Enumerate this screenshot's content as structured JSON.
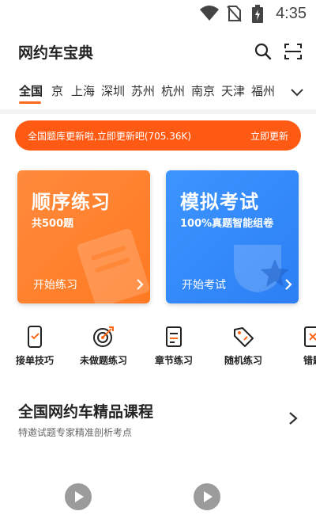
{
  "status_bar": {
    "time": "4:35"
  },
  "header": {
    "title": "网约车宝典"
  },
  "tabs": {
    "items": [
      {
        "label": "全国",
        "active": true
      },
      {
        "label": "京"
      },
      {
        "label": "上海"
      },
      {
        "label": "深圳"
      },
      {
        "label": "苏州"
      },
      {
        "label": "杭州"
      },
      {
        "label": "南京"
      },
      {
        "label": "天津"
      },
      {
        "label": "福州"
      }
    ]
  },
  "banner": {
    "message": "全国题库更新啦,立即更新吧(705.36K)",
    "action": "立即更新"
  },
  "cards": [
    {
      "title": "顺序练习",
      "subtitle": "共500题",
      "start": "开始练习",
      "color": "#ff7a22"
    },
    {
      "title": "模拟考试",
      "subtitle": "100%真题智能组卷",
      "start": "开始考试",
      "color": "#2d7ff4"
    }
  ],
  "quick": [
    {
      "label": "接单技巧",
      "icon": "phone-icon"
    },
    {
      "label": "未做题练习",
      "icon": "target-icon"
    },
    {
      "label": "章节练习",
      "icon": "document-icon"
    },
    {
      "label": "随机练习",
      "icon": "tag-icon"
    },
    {
      "label": "错题",
      "icon": "wrong-answer-icon"
    }
  ],
  "course": {
    "title": "全国网约车精品课程",
    "subtitle": "特邀试题专家精准剖析考点"
  },
  "colors": {
    "accent": "#ff5a14",
    "orange_card": "#ff7a22",
    "blue_card": "#2d7ff4"
  }
}
